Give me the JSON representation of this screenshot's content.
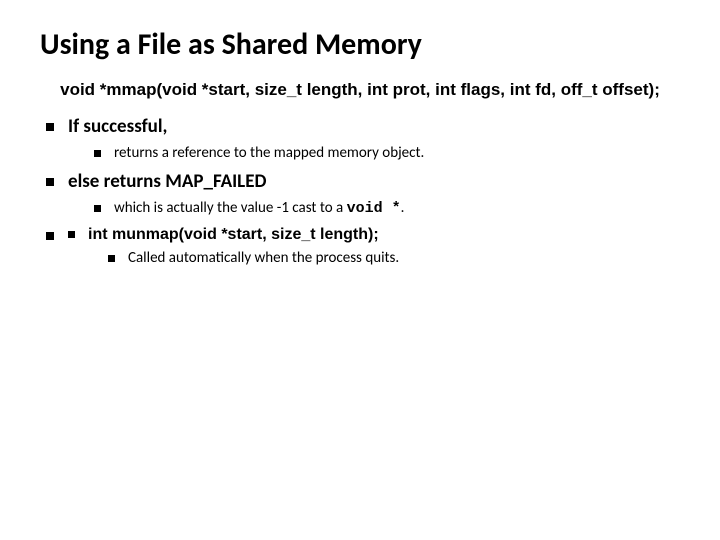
{
  "title": "Using a File as Shared Memory",
  "prototype": "void *mmap(void *start, size_t length, int prot, int flags, int fd, off_t offset);",
  "b1": "If successful,",
  "b1_sub": "returns a reference to the mapped memory object.",
  "b2": "else returns MAP_FAILED",
  "b2_sub_pre": "which is actually the value -1 cast to a ",
  "b2_sub_code": "void *",
  "b2_sub_post": ".",
  "b3": "int munmap(void *start, size_t length);",
  "b3_sub": "Called automatically when the process quits."
}
